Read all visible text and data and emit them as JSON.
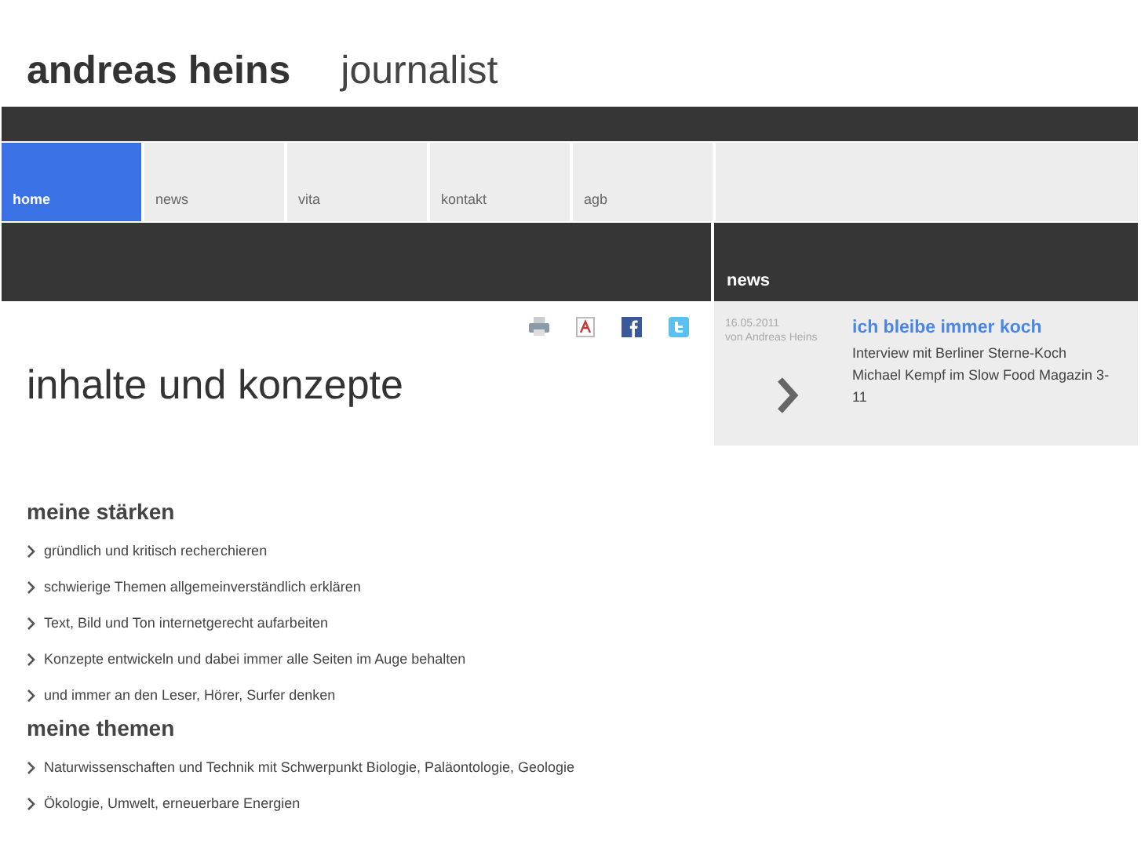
{
  "header": {
    "name": "andreas heins",
    "role": "journalist"
  },
  "nav": [
    {
      "label": "home",
      "selected": true
    },
    {
      "label": "news",
      "selected": false
    },
    {
      "label": "vita",
      "selected": false
    },
    {
      "label": "kontakt",
      "selected": false
    },
    {
      "label": "agb",
      "selected": false
    }
  ],
  "news_panel": {
    "title": "news",
    "date": "16.05.2011",
    "author": "von Andreas Heins",
    "headline": "ich bleibe immer koch",
    "teaser": "Interview mit Berliner Sterne-Koch Michael Kempf im Slow Food Magazin 3-11"
  },
  "page_title": "inhalte und konzepte",
  "sections": [
    {
      "heading": "meine stärken",
      "items": [
        "gründlich und kritisch recherchieren",
        "schwierige Themen allgemeinverständlich erklären",
        "Text, Bild und Ton internetgerecht aufarbeiten",
        "Konzepte entwickeln und dabei immer alle Seiten im Auge behalten",
        "und immer an den Leser, Hörer, Surfer denken"
      ]
    },
    {
      "heading": "meine themen",
      "items": [
        "Naturwissenschaften und Technik mit Schwerpunkt Biologie, Paläontologie, Geologie",
        "Ökologie, Umwelt, erneuerbare Energien"
      ]
    }
  ]
}
